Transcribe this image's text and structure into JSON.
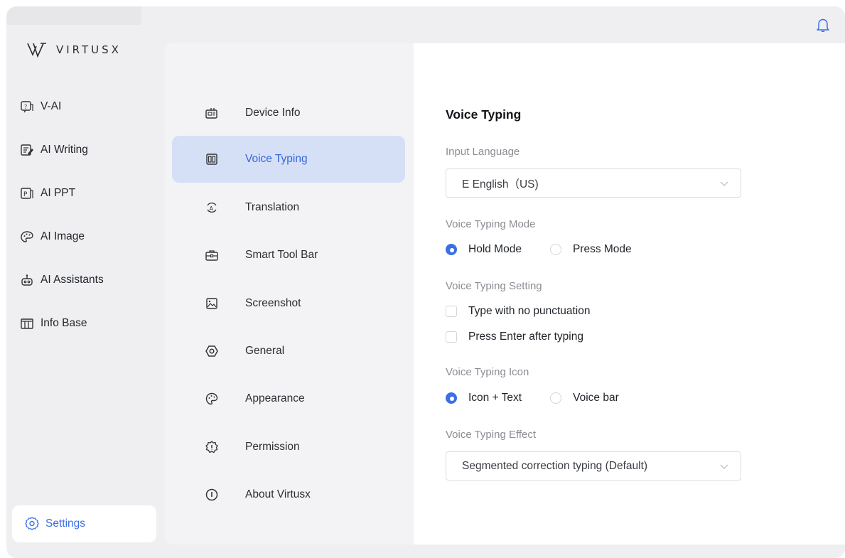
{
  "app": {
    "brand": "VIRTUSX"
  },
  "header": {
    "bell_icon": "bell-icon"
  },
  "sidebar": {
    "items": [
      {
        "label": "V-AI",
        "icon": "chat-question-icon"
      },
      {
        "label": "AI Writing",
        "icon": "edit-document-icon"
      },
      {
        "label": "AI PPT",
        "icon": "presentation-icon"
      },
      {
        "label": "AI Image",
        "icon": "palette-image-icon"
      },
      {
        "label": "AI Assistants",
        "icon": "robot-icon"
      },
      {
        "label": "Info Base",
        "icon": "library-icon"
      }
    ],
    "settings": {
      "label": "Settings",
      "icon": "gear-icon"
    }
  },
  "submenu": {
    "items": [
      {
        "label": "Device Info",
        "icon": "device-info-icon"
      },
      {
        "label": "Voice Typing",
        "icon": "voice-typing-icon",
        "active": true
      },
      {
        "label": "Translation",
        "icon": "translation-icon"
      },
      {
        "label": "Smart Tool Bar",
        "icon": "toolbox-icon"
      },
      {
        "label": "Screenshot",
        "icon": "screenshot-icon"
      },
      {
        "label": "General",
        "icon": "general-settings-icon"
      },
      {
        "label": "Appearance",
        "icon": "appearance-palette-icon"
      },
      {
        "label": "Permission",
        "icon": "permission-shield-icon"
      },
      {
        "label": "About Virtusx",
        "icon": "info-icon"
      }
    ]
  },
  "voice_typing": {
    "title": "Voice Typing",
    "input_language": {
      "label": "Input Language",
      "value": "E English（US)"
    },
    "mode": {
      "label": "Voice Typing Mode",
      "options": [
        "Hold Mode",
        "Press Mode"
      ],
      "selected": "Hold Mode"
    },
    "setting": {
      "label": "Voice Typing Setting",
      "options": [
        "Type with no punctuation",
        "Press Enter after typing"
      ],
      "checked": [
        false,
        false
      ]
    },
    "icon": {
      "label": "Voice Typing Icon",
      "options": [
        "Icon + Text",
        "Voice bar"
      ],
      "selected": "Icon + Text"
    },
    "effect": {
      "label": "Voice Typing Effect",
      "value": "Segmented correction typing (Default)"
    }
  },
  "colors": {
    "accent": "#3b6fe6",
    "active_bg": "#d5e0f7",
    "sidebar_bg": "#efeff1",
    "submenu_bg": "#f3f3f5"
  }
}
